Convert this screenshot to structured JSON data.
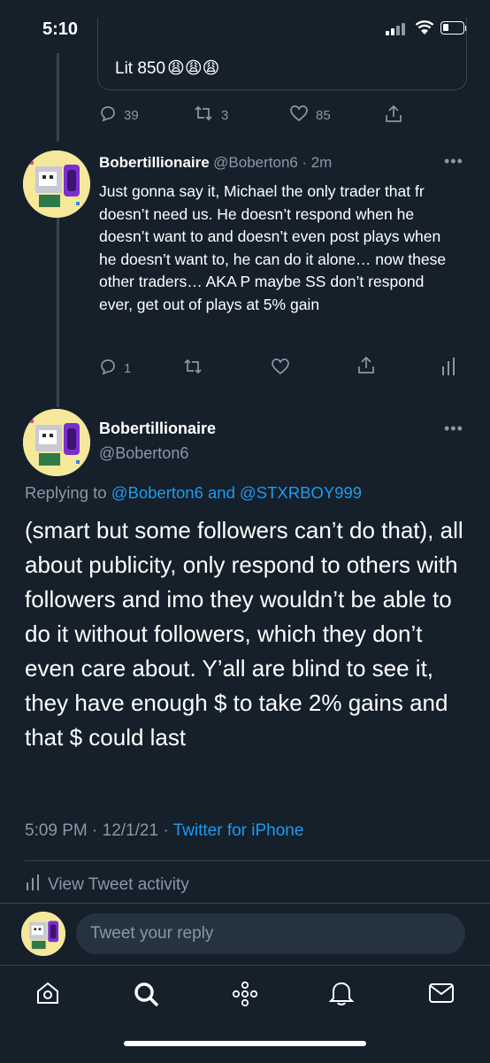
{
  "status_bar": {
    "time": "5:10"
  },
  "quoted_tweet": {
    "text": "Lit 850",
    "emoji": "😩😩😩",
    "replies": "39",
    "retweets": "3",
    "likes": "85"
  },
  "reply_tweet": {
    "display_name": "Bobertillionaire",
    "handle": "@Boberton6",
    "time": "· 2m",
    "text": "Just gonna say it, Michael the only trader that fr doesn’t need us. He doesn’t respond when he doesn’t want to and doesn’t even post plays when he doesn’t want to, he can do it alone… now these other traders… AKA P maybe SS don’t respond ever, get out of plays at 5% gain",
    "replies": "1"
  },
  "main_tweet": {
    "display_name": "Bobertillionaire",
    "handle": "@Boberton6",
    "replying_to_label": "Replying to",
    "replying_to_user1": "@Boberton6",
    "replying_to_and": "and",
    "replying_to_user2": "@STXRBOY999",
    "text": "(smart but some followers can’t do that), all about publicity, only respond to others with followers and imo they wouldn’t be able to do it without followers, which they don’t even care about. Y’all are blind to see it, they have enough $ to take 2% gains and that $ could last",
    "timestamp": "5:09 PM · 12/1/21 ·",
    "source": "Twitter for iPhone",
    "activity_label": "View Tweet activity"
  },
  "reply_box": {
    "placeholder": "Tweet your reply"
  },
  "tab_bar": {
    "items": [
      "home-icon",
      "search-icon",
      "spaces-icon",
      "notifications-icon",
      "messages-icon"
    ]
  },
  "colors": {
    "background": "#15202b",
    "link": "#1d9bf0",
    "muted": "#8899a6",
    "divider": "#38444d"
  }
}
